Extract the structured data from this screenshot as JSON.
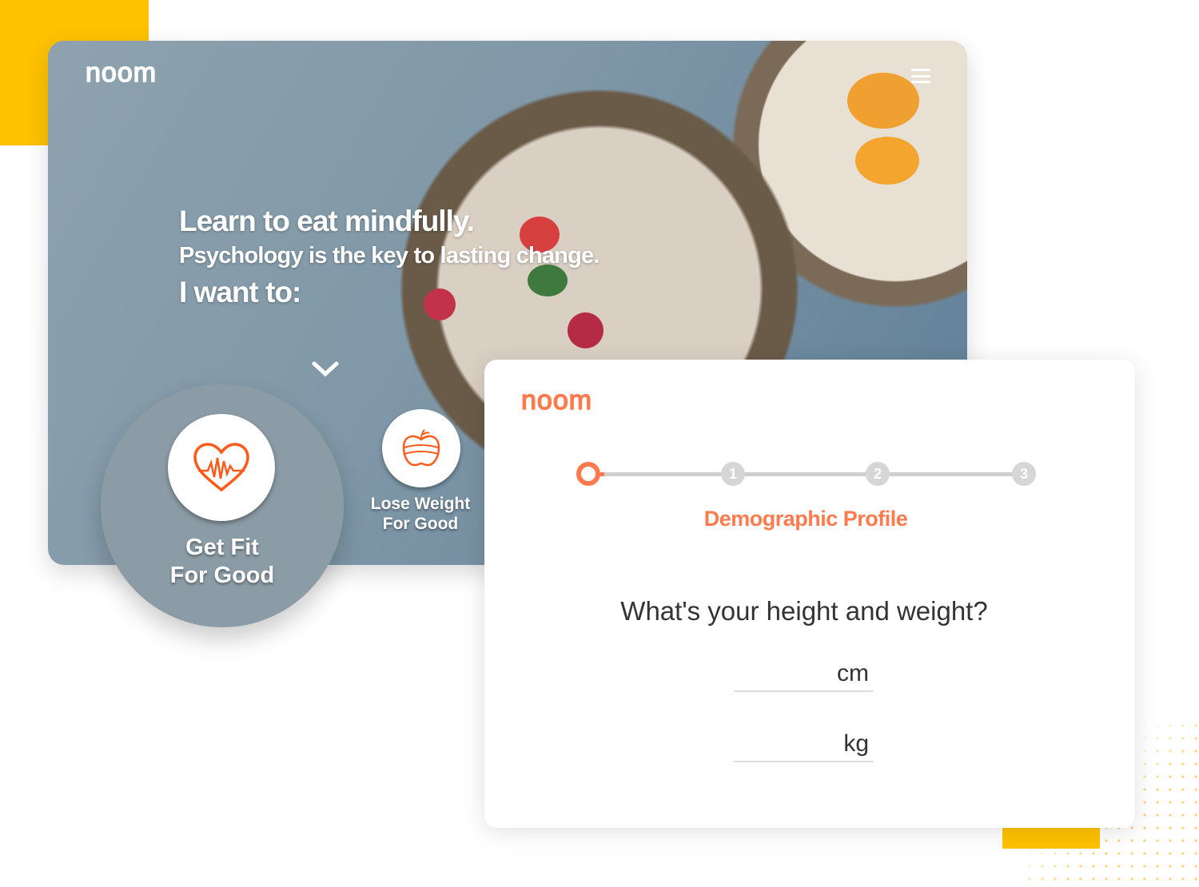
{
  "colors": {
    "accent": "#ff7a4d",
    "yellow": "#FFC200"
  },
  "hero": {
    "logo": "noom",
    "menu_icon": "hamburger-icon",
    "headline": "Learn to eat mindfully.",
    "subheadline": "Psychology is the key to lasting change.",
    "prompt": "I want to:",
    "options": [
      {
        "label_1": "Get Fit",
        "label_2": "For Good",
        "icon": "heart-pulse-icon"
      },
      {
        "label_1": "Lose Weight",
        "label_2": "For Good",
        "icon": "apple-measuring-tape-icon"
      }
    ]
  },
  "form": {
    "logo": "noom",
    "steps": [
      "",
      "1",
      "2",
      "3"
    ],
    "current_step": 0,
    "step_title": "Demographic Profile",
    "question": "What's your height and weight?",
    "height_unit": "cm",
    "weight_unit": "kg"
  }
}
